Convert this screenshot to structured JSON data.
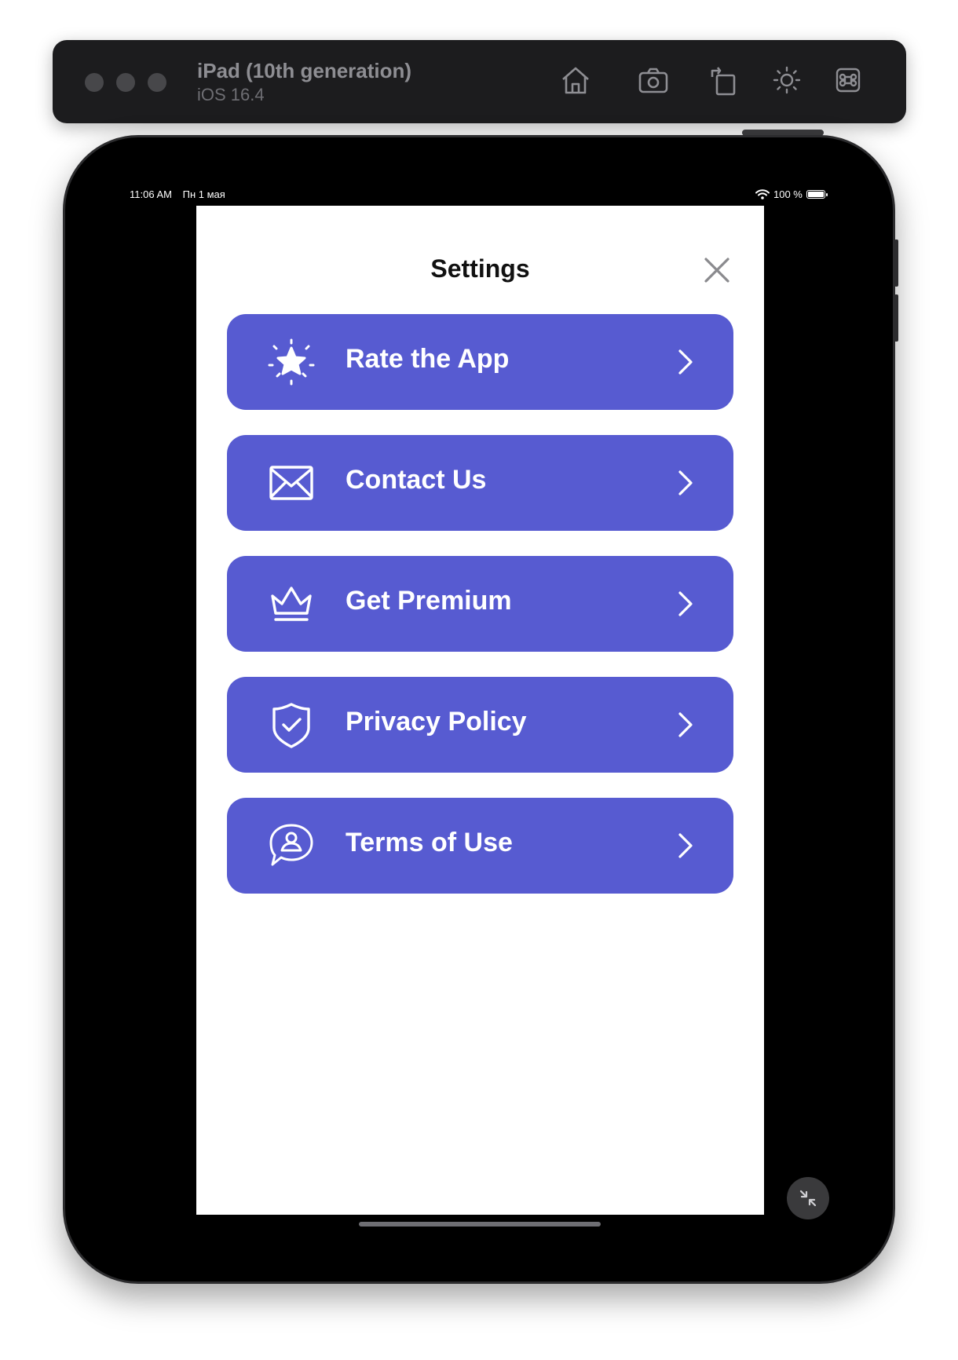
{
  "simulator": {
    "device_name": "iPad (10th generation)",
    "os_version": "iOS 16.4",
    "toolbar_icons": [
      "home-icon",
      "screenshot-icon",
      "rotate-icon",
      "appearance-icon",
      "command-icon"
    ]
  },
  "status_bar": {
    "time": "11:06 AM",
    "date": "Пн 1 мая",
    "battery": "100 %"
  },
  "settings": {
    "title": "Settings",
    "close_icon": "close-icon",
    "items": [
      {
        "label": "Rate the App",
        "icon": "star-burst-icon"
      },
      {
        "label": "Contact Us",
        "icon": "envelope-icon"
      },
      {
        "label": "Get Premium",
        "icon": "crown-icon"
      },
      {
        "label": "Privacy Policy",
        "icon": "shield-check-icon"
      },
      {
        "label": "Terms of Use",
        "icon": "chat-person-icon"
      }
    ]
  },
  "colors": {
    "accent": "#575bd1",
    "sheet_bg": "#ffffff",
    "device_bg": "#000000",
    "toolbar_bg": "#1c1c1e"
  }
}
